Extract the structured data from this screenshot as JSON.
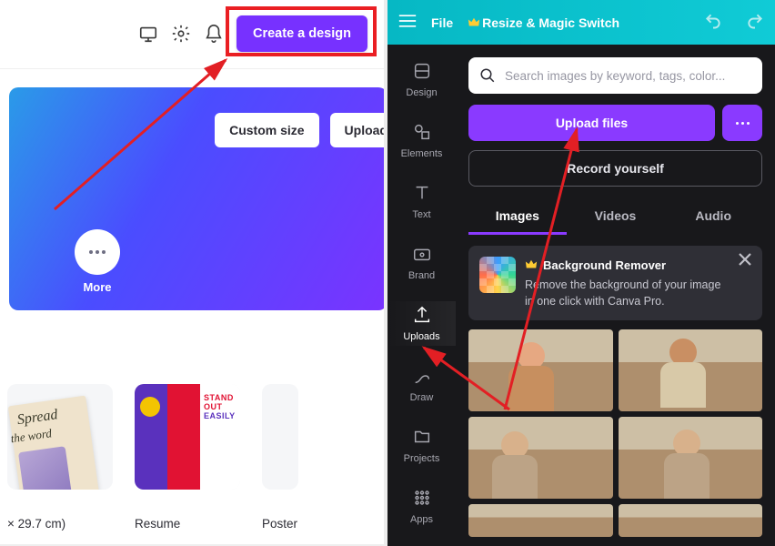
{
  "left": {
    "create_label": "Create a design",
    "custom_size": "Custom size",
    "upload": "Upload",
    "more_label": "More",
    "thumb1": {
      "line1": "Spread",
      "line2": "the word"
    },
    "thumb2": {
      "stand": "STAND OUT",
      "easily": "EASILY"
    },
    "caption1": "× 29.7 cm)",
    "caption2": "Resume",
    "caption3": "Poster"
  },
  "right": {
    "top": {
      "file": "File",
      "resize": "Resize & Magic Switch"
    },
    "rail": [
      {
        "key": "design",
        "label": "Design"
      },
      {
        "key": "elements",
        "label": "Elements"
      },
      {
        "key": "text",
        "label": "Text"
      },
      {
        "key": "brand",
        "label": "Brand"
      },
      {
        "key": "uploads",
        "label": "Uploads"
      },
      {
        "key": "draw",
        "label": "Draw"
      },
      {
        "key": "projects",
        "label": "Projects"
      },
      {
        "key": "apps",
        "label": "Apps"
      }
    ],
    "search_placeholder": "Search images by keyword, tags, color...",
    "upload_files": "Upload files",
    "record_yourself": "Record yourself",
    "tabs": {
      "images": "Images",
      "videos": "Videos",
      "audio": "Audio"
    },
    "promo": {
      "title": "Background Remover",
      "desc": "Remove the background of your image in one click with Canva Pro."
    }
  }
}
